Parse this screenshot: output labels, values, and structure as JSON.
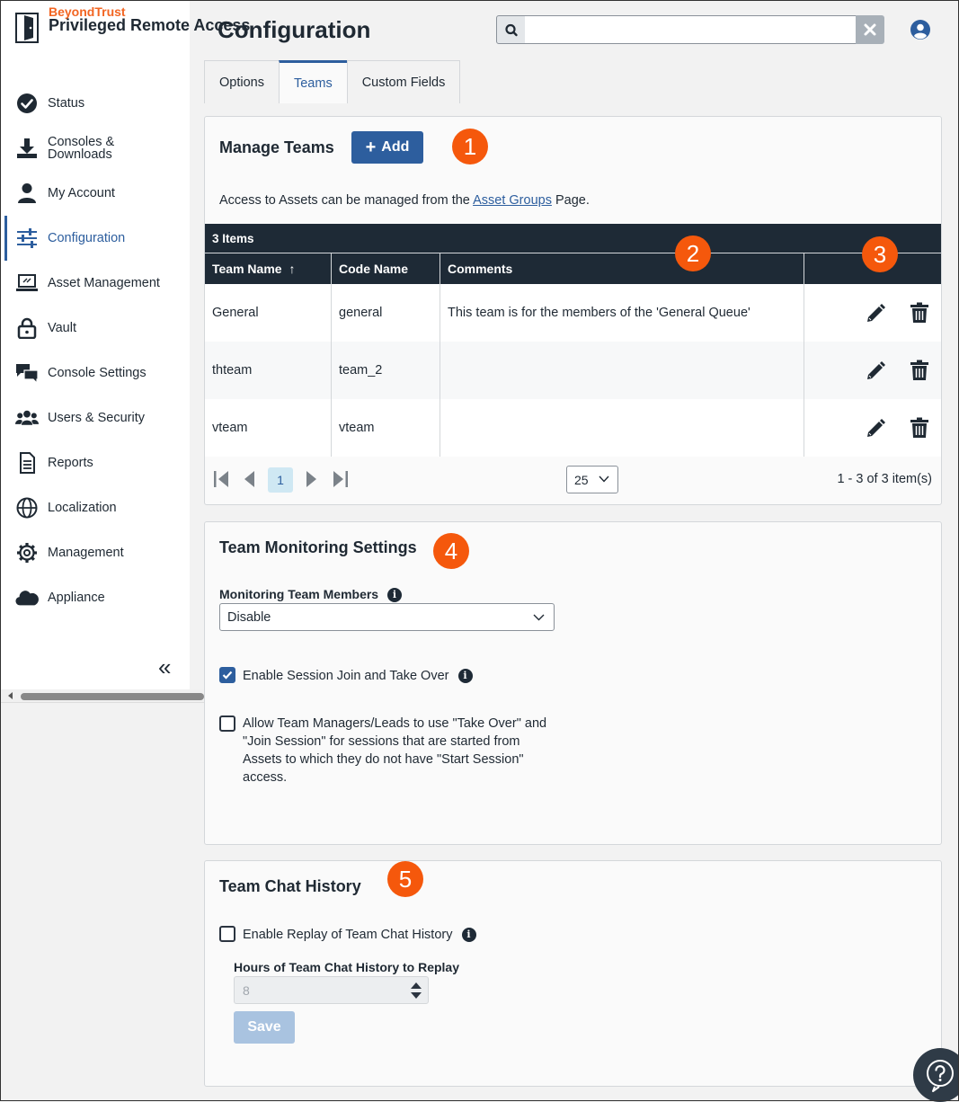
{
  "brand": {
    "company": "BeyondTrust",
    "product": "Privileged Remote Access"
  },
  "sidebar": {
    "items": [
      {
        "label": "Status",
        "icon": "check-circle-icon"
      },
      {
        "label": "Consoles & Downloads",
        "icon": "download-icon"
      },
      {
        "label": "My Account",
        "icon": "user-icon"
      },
      {
        "label": "Configuration",
        "icon": "sliders-icon",
        "active": true
      },
      {
        "label": "Asset Management",
        "icon": "laptop-icon"
      },
      {
        "label": "Vault",
        "icon": "lock-icon"
      },
      {
        "label": "Console Settings",
        "icon": "chat-bubbles-icon"
      },
      {
        "label": "Users & Security",
        "icon": "users-icon"
      },
      {
        "label": "Reports",
        "icon": "document-icon"
      },
      {
        "label": "Localization",
        "icon": "globe-icon"
      },
      {
        "label": "Management",
        "icon": "gear-icon"
      },
      {
        "label": "Appliance",
        "icon": "cloud-icon"
      }
    ],
    "collapse_glyph": "«"
  },
  "header": {
    "title": "Configuration",
    "search_value": ""
  },
  "tabs": [
    {
      "label": "Options"
    },
    {
      "label": "Teams",
      "active": true
    },
    {
      "label": "Custom Fields"
    }
  ],
  "manage_teams": {
    "title": "Manage Teams",
    "add_label": "Add",
    "add_glyph": "+",
    "info_prefix": "Access to Assets can be managed from the",
    "info_link": "Asset Groups",
    "info_suffix": "Page.",
    "item_count": "3 Items",
    "columns": [
      "Team Name",
      "Code Name",
      "Comments",
      ""
    ],
    "sort_glyph": "↑",
    "rows": [
      {
        "team_name": "General",
        "code_name": "general",
        "comments": "This team is for the members of the 'General Queue'"
      },
      {
        "team_name": "thteam",
        "code_name": "team_2",
        "comments": ""
      },
      {
        "team_name": "vteam",
        "code_name": "vteam",
        "comments": ""
      }
    ],
    "pager": {
      "current_page": "1",
      "page_size": "25",
      "summary": "1 - 3 of 3 item(s)"
    }
  },
  "monitoring": {
    "title": "Team Monitoring Settings",
    "members_label": "Monitoring Team Members",
    "members_value": "Disable",
    "session_join_label": "Enable Session Join and Take Over",
    "session_join_checked": true,
    "managers_label": "Allow Team Managers/Leads to use \"Take Over\" and \"Join Session\" for sessions that are started from Assets to which they do not have \"Start Session\" access.",
    "managers_checked": false
  },
  "chat_history": {
    "title": "Team Chat History",
    "replay_label": "Enable Replay of Team Chat History",
    "replay_checked": false,
    "hours_label": "Hours of Team Chat History to Replay",
    "hours_value": "8",
    "save_label": "Save"
  },
  "badges": [
    "1",
    "2",
    "3",
    "4",
    "5"
  ],
  "colors": {
    "accent": "#2d5e9e",
    "badge": "#f5580c",
    "grid_header": "#1e2a36",
    "brand_orange": "#f26522"
  }
}
